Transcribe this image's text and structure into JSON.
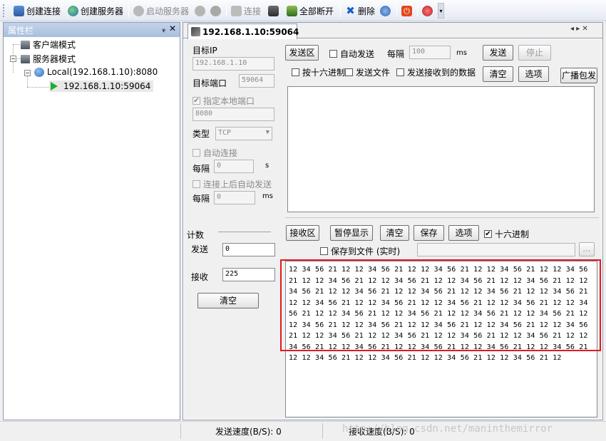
{
  "toolbar": {
    "create_connection": "创建连接",
    "create_server": "创建服务器",
    "start_server": "启动服务器",
    "connect": "连接",
    "disconnect_all": "全部断开",
    "delete": "删除"
  },
  "sidebar": {
    "title": "属性栏",
    "pin": "ᵩ",
    "close": "✕",
    "client_mode": "客户端模式",
    "server_mode": "服务器模式",
    "local_server": "Local(192.168.1.10):8080",
    "client_node": "192.168.1.10:59064"
  },
  "tab": {
    "label": "192.168.1.10:59064",
    "nav": "◂ ▸ ✕"
  },
  "settings": {
    "target_ip_label": "目标IP",
    "target_ip": "192.168.1.10",
    "target_port_label": "目标端口",
    "target_port": "59064",
    "specify_local_port_label": "指定本地端口",
    "local_port": "8080",
    "type_label": "类型",
    "type_value": "TCP",
    "auto_connect_label": "自动连接",
    "every_label": "每隔",
    "auto_connect_interval": "0",
    "seconds_unit": "s",
    "auto_send_on_connect_label": "连接上后自动发送",
    "auto_send_interval": "0",
    "ms_unit": "ms"
  },
  "counter": {
    "title": "计数",
    "send_label": "发送",
    "send_value": "0",
    "recv_label": "接收",
    "recv_value": "225",
    "clear_button": "清空"
  },
  "send_area": {
    "title_button": "发送区",
    "auto_send_label": "自动发送",
    "every_label": "每隔",
    "interval": "100",
    "ms_unit": "ms",
    "send_button": "发送",
    "stop_button": "停止",
    "hex_send_label": "按十六进制",
    "send_file_label": "发送文件",
    "send_received_label": "发送接收到的数据",
    "clear_button": "清空",
    "options_button": "选项",
    "broadcast_button": "广播包发"
  },
  "recv_area": {
    "title_button": "接收区",
    "pause_button": "暂停显示",
    "clear_button": "清空",
    "save_button": "保存",
    "options_button": "选项",
    "hex_label": "十六进制",
    "hex_checked": true,
    "save_to_file_label": "保存到文件 (实时)",
    "browse_button": "...",
    "content": "12 34 56 21 12 12 34 56 21 12 12 34 56 21 12 12 34 56 21 12 12 34 56 21 12 12 34 56 21 12 12 34 56 21 12 12 34 56 21 12 12 34 56 21 12 12 34 56 21 12 12 34 56 21 12 12 34 56 21 12 12 34 56 21 12 12 34 56 21 12 12 34 56 21 12 12 34 56 21 12 12 34 56 21 12 12 34 56 21 12 12 34 56 21 12 12 34 56 21 12 12 34 56 21 12 12 34 56 21 12 12 34 56 21 12 12 34 56 21 12 12 34 56 21 12 12 34 56 21 12 12 34 56 21 12 12 34 56 21 12 12 34 56 21 12 12 34 56 21 12 12 34 56 21 12 12 34 56 21 12 12 34 56 21 12 12 34 56 21 12 12 34 56 21 12 12 34 56 21 12 12 34 56 21 12 12 34 56 21 12 12 34 56 21 12 12 34 56 21 12 12 34 56 21 12"
  },
  "status": {
    "send_speed": "发送速度(B/S): 0",
    "recv_speed": "接收速度(B/S): 0",
    "watermark": "http://blog.csdn.net/maninthemirror"
  }
}
